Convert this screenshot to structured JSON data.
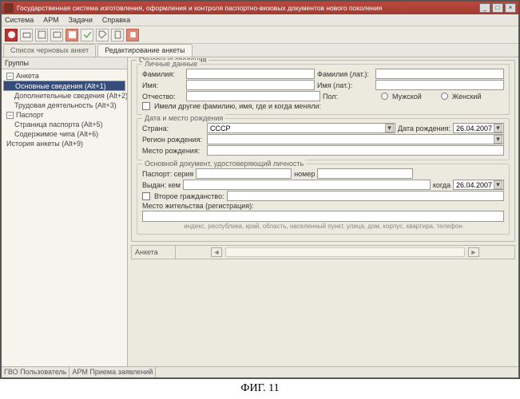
{
  "titlebar": {
    "text": "Государственная система изготовления, оформления и контроля паспортно-визовых документов нового поколения"
  },
  "menu": {
    "m0": "Система",
    "m1": "АРМ",
    "m2": "Задачи",
    "m3": "Справка"
  },
  "tabs": {
    "t0": "Список черновых анкет",
    "t1": "Редактирование анкеты"
  },
  "side": {
    "header": "Группы",
    "root": "Анкета",
    "n0": "Основные сведения (Alt+1)",
    "n1": "Дополнительные сведения (Alt+2)",
    "n2": "Трудовая деятельность (Alt+3)",
    "root2": "Паспорт",
    "n3": "Страница паспорта (Alt+5)",
    "n4": "Содержимое чипа (Alt+6)",
    "n5": "История анкеты (Alt+9)"
  },
  "sec": {
    "main": "Основные сведения",
    "personal": "Личные данные",
    "surname": "Фамилия:",
    "surname_lat": "Фамилия (лат.):",
    "name": "Имя:",
    "name_lat": "Имя (лат.):",
    "patr": "Отчество:",
    "sex": "Пол:",
    "sex_m": "Мужской",
    "sex_f": "Женский",
    "hadother": "Имели другие фамилию, имя, где и когда меняли:",
    "birth": "Дата и место рождения",
    "country": "Страна:",
    "country_val": "СССР",
    "dob": "Дата рождения:",
    "dob_val": "26.04.2007",
    "region": "Регион рождения:",
    "place": "Место рождения:",
    "doc": "Основной документ, удостоверяющий личность",
    "passser": "Паспорт: серия",
    "num": "номер",
    "issued": "Выдан: кем",
    "when": "когда",
    "when_val": "26.04.2007",
    "dual": "Второе гражданство:",
    "addr": "Место жительства (регистрация):",
    "addr_hint": "индекс, республика, край, область, населенный пункт, улица, дом, корпус, квартира, телефон"
  },
  "footer": {
    "label": "Анкета"
  },
  "status": {
    "s0": "ГВО Пользователь",
    "s1": "АРМ Приема заявлений"
  },
  "caption": "ФИГ. 11"
}
